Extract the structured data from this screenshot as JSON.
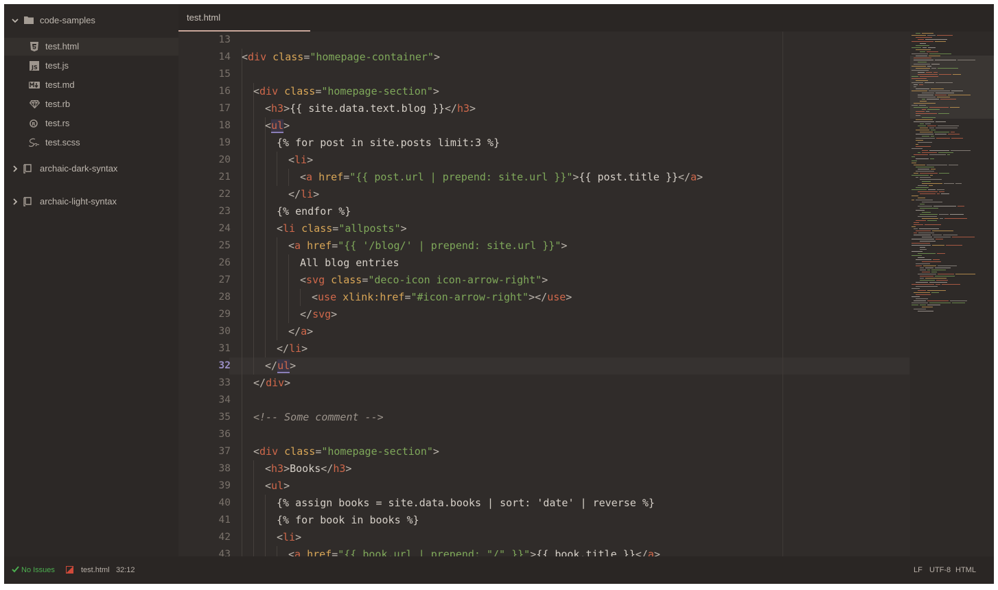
{
  "sidebar": {
    "root": "code-samples",
    "files": [
      {
        "name": "test.html",
        "icon": "html5-icon"
      },
      {
        "name": "test.js",
        "icon": "js-icon"
      },
      {
        "name": "test.md",
        "icon": "markdown-icon"
      },
      {
        "name": "test.rb",
        "icon": "ruby-icon"
      },
      {
        "name": "test.rs",
        "icon": "rust-icon"
      },
      {
        "name": "test.scss",
        "icon": "sass-icon"
      }
    ],
    "projects": [
      "archaic-dark-syntax",
      "archaic-light-syntax"
    ]
  },
  "tab": {
    "label": "test.html"
  },
  "editor": {
    "current_line": "32",
    "line_numbers": [
      "13",
      "14",
      "15",
      "16",
      "17",
      "18",
      "19",
      "20",
      "21",
      "22",
      "23",
      "24",
      "25",
      "26",
      "27",
      "28",
      "29",
      "30",
      "31",
      "32",
      "33",
      "34",
      "35",
      "36",
      "37",
      "38",
      "39",
      "40",
      "41",
      "42",
      "43"
    ],
    "code": {
      "l14_tag": "div",
      "l14_attr": "class",
      "l14_val": "\"homepage-container\"",
      "l16_tag": "div",
      "l16_attr": "class",
      "l16_val": "\"homepage-section\"",
      "l17_tag": "h3",
      "l17_text": "{{ site.data.text.blog }}",
      "l17_close": "h3",
      "l18_tag": "ul",
      "l19_text": "{% for post in site.posts limit:3 %}",
      "l20_tag": "li",
      "l21_tag": "a",
      "l21_attr": "href",
      "l21_val": "\"{{ post.url | prepend: site.url }}\"",
      "l21_text": "{{ post.title }}",
      "l21_close": "a",
      "l22_close": "li",
      "l23_text": "{% endfor %}",
      "l24_tag": "li",
      "l24_attr": "class",
      "l24_val": "\"allposts\"",
      "l25_tag": "a",
      "l25_attr": "href",
      "l25_val": "\"{{ '/blog/' | prepend: site.url }}\"",
      "l26_text": "All blog entries",
      "l27_tag": "svg",
      "l27_attr": "class",
      "l27_val": "\"deco-icon icon-arrow-right\"",
      "l28_tag": "use",
      "l28_attr": "xlink:href",
      "l28_val": "\"#icon-arrow-right\"",
      "l28_close": "use",
      "l29_close": "svg",
      "l30_close": "a",
      "l31_close": "li",
      "l32_close": "ul",
      "l33_close": "div",
      "l35_comment": "<!-- Some comment -->",
      "l37_tag": "div",
      "l37_attr": "class",
      "l37_val": "\"homepage-section\"",
      "l38_tag": "h3",
      "l38_text": "Books",
      "l38_close": "h3",
      "l39_tag": "ul",
      "l40_text": "{% assign books = site.data.books | sort: 'date' | reverse %}",
      "l41_text": "{% for book in books %}",
      "l42_tag": "li",
      "l43_tag": "a",
      "l43_attr": "href",
      "l43_val": "\"{{ book.url | prepend: \"/\" }}\"",
      "l43_text": "{{ book.title }}",
      "l43_close": "a"
    }
  },
  "status": {
    "issues": "No Issues",
    "file": "test.html",
    "cursor": "32:12",
    "line_ending": "LF",
    "encoding": "UTF-8",
    "grammar": "HTML"
  },
  "colors": {
    "background": "#302c2a",
    "tag": "#d0684b",
    "attribute": "#d8a657",
    "string": "#7fa85a",
    "accent": "#9a8ec4",
    "success": "#4caf50"
  }
}
